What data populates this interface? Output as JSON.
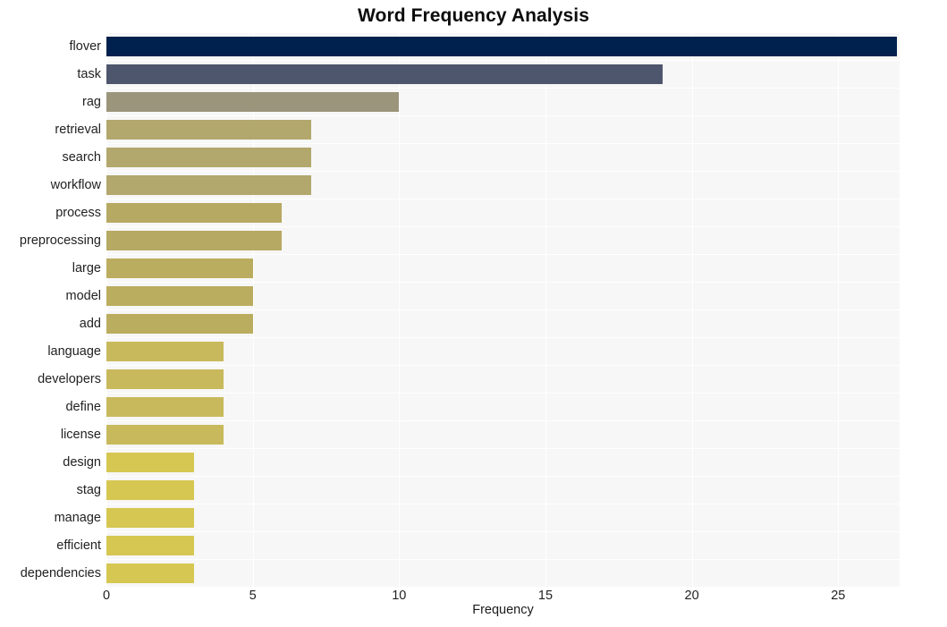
{
  "chart_data": {
    "type": "bar",
    "orientation": "horizontal",
    "title": "Word Frequency Analysis",
    "xlabel": "Frequency",
    "ylabel": "",
    "xlim": [
      0,
      27.1
    ],
    "ylim": null,
    "grid": true,
    "legend": null,
    "xticks": [
      "0",
      "5",
      "10",
      "15",
      "20",
      "25"
    ],
    "xtick_values": [
      0,
      5,
      10,
      15,
      20,
      25
    ],
    "categories": [
      "flover",
      "task",
      "rag",
      "retrieval",
      "search",
      "workflow",
      "process",
      "preprocessing",
      "large",
      "model",
      "add",
      "language",
      "developers",
      "define",
      "license",
      "design",
      "stag",
      "manage",
      "efficient",
      "dependencies"
    ],
    "values": [
      27,
      19,
      10,
      7,
      7,
      7,
      6,
      6,
      5,
      5,
      5,
      4,
      4,
      4,
      4,
      3,
      3,
      3,
      3,
      3
    ],
    "bar_colors": [
      "#00214d",
      "#4e566e",
      "#9a957b",
      "#b2a76c",
      "#b2a76c",
      "#b2a76c",
      "#b6a963",
      "#b6a963",
      "#bbad5f",
      "#bbad5f",
      "#bbad5f",
      "#c8ba5c",
      "#c8ba5c",
      "#c8ba5c",
      "#c8ba5c",
      "#d6c752",
      "#d6c752",
      "#d6c752",
      "#d6c752",
      "#d6c752"
    ],
    "plot_background": "#f7f7f7",
    "grid_color": "#ffffff",
    "figure_background": "#ffffff",
    "colormap": "cividis"
  }
}
